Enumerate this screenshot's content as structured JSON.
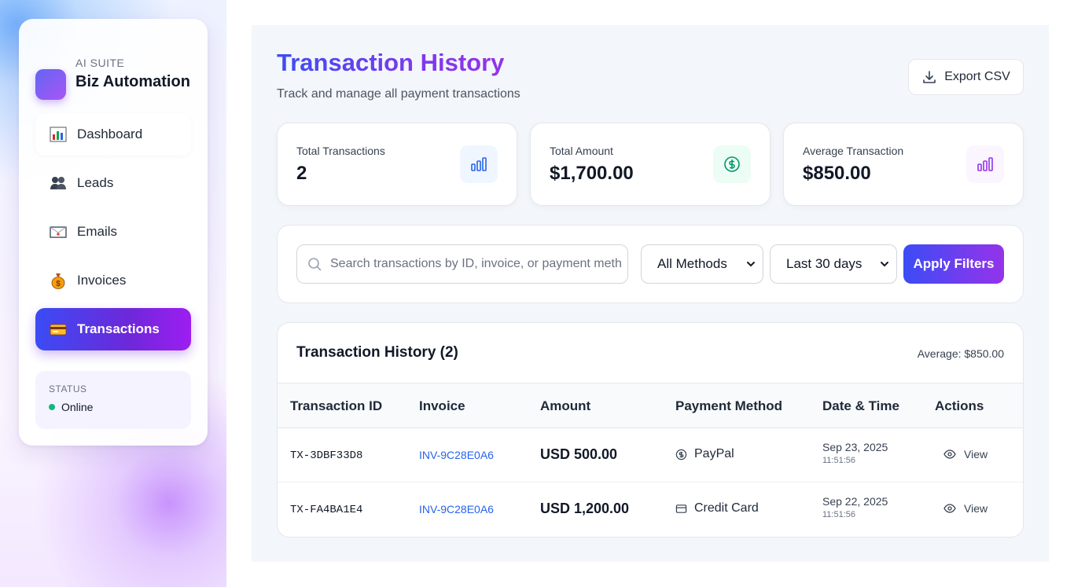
{
  "brand": {
    "subtitle": "AI SUITE",
    "title": "Biz Automation"
  },
  "sidebar": {
    "items": [
      {
        "label": "Dashboard",
        "icon": "bar-chart-icon"
      },
      {
        "label": "Leads",
        "icon": "people-icon"
      },
      {
        "label": "Emails",
        "icon": "envelope-icon"
      },
      {
        "label": "Invoices",
        "icon": "money-bag-icon"
      },
      {
        "label": "Transactions",
        "icon": "credit-card-icon",
        "active": true
      }
    ],
    "status": {
      "label": "STATUS",
      "value": "Online",
      "color": "#10b981"
    }
  },
  "header": {
    "title": "Transaction History",
    "subtitle": "Track and manage all payment transactions",
    "export_label": "Export CSV"
  },
  "stats": [
    {
      "label": "Total Transactions",
      "value": "2",
      "icon": "bar-chart-icon",
      "accent": "#2563eb"
    },
    {
      "label": "Total Amount",
      "value": "$1,700.00",
      "icon": "dollar-icon",
      "accent": "#059669"
    },
    {
      "label": "Average Transaction",
      "value": "$850.00",
      "icon": "bar-chart-icon",
      "accent": "#9333ea"
    }
  ],
  "filters": {
    "search_placeholder": "Search transactions by ID, invoice, or payment method...",
    "method_selected": "All Methods",
    "range_selected": "Last 30 days",
    "apply_label": "Apply Filters"
  },
  "table": {
    "title": "Transaction History (2)",
    "average": "Average: $850.00",
    "columns": [
      "Transaction ID",
      "Invoice",
      "Amount",
      "Payment Method",
      "Date & Time",
      "Actions"
    ],
    "rows": [
      {
        "id": "TX-3DBF33D8",
        "invoice": "INV-9C28E0A6",
        "amount": "USD 500.00",
        "method": "PayPal",
        "method_icon": "dollar-circle-icon",
        "date": "Sep 23, 2025",
        "time": "11:51:56",
        "action": "View"
      },
      {
        "id": "TX-FA4BA1E4",
        "invoice": "INV-9C28E0A6",
        "amount": "USD 1,200.00",
        "method": "Credit Card",
        "method_icon": "card-icon",
        "date": "Sep 22, 2025",
        "time": "11:51:56",
        "action": "View"
      }
    ]
  }
}
